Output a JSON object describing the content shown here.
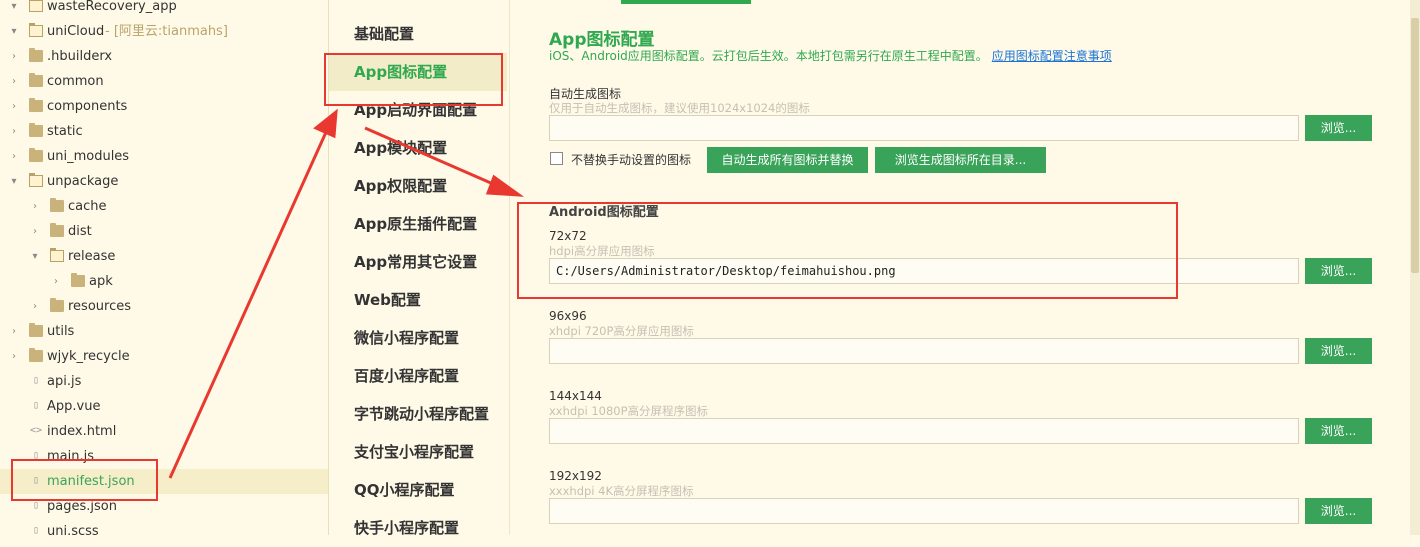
{
  "tree": {
    "items": [
      {
        "label": "wasteRecovery_app",
        "type": "folder-open",
        "level": 0
      },
      {
        "label": "uniCloud",
        "sub": "- [阿里云:tianmahs]",
        "type": "folder-open",
        "level": 0
      },
      {
        "label": ".hbuilderx",
        "type": "folder",
        "level": 0
      },
      {
        "label": "common",
        "type": "folder",
        "level": 0
      },
      {
        "label": "components",
        "type": "folder",
        "level": 0
      },
      {
        "label": "static",
        "type": "folder",
        "level": 0
      },
      {
        "label": "uni_modules",
        "type": "folder",
        "level": 0
      },
      {
        "label": "unpackage",
        "type": "folder-open",
        "level": 0
      },
      {
        "label": "cache",
        "type": "folder",
        "level": 1
      },
      {
        "label": "dist",
        "type": "folder",
        "level": 1
      },
      {
        "label": "release",
        "type": "folder-open",
        "level": 1
      },
      {
        "label": "apk",
        "type": "folder",
        "level": 2
      },
      {
        "label": "resources",
        "type": "folder",
        "level": 1
      },
      {
        "label": "utils",
        "type": "folder",
        "level": 0
      },
      {
        "label": "wjyk_recycle",
        "type": "folder",
        "level": 0
      },
      {
        "label": "api.js",
        "type": "file",
        "level": 0
      },
      {
        "label": "App.vue",
        "type": "file",
        "level": 0
      },
      {
        "label": "index.html",
        "type": "file",
        "level": 0
      },
      {
        "label": "main.js",
        "type": "file",
        "level": 0
      },
      {
        "label": "manifest.json",
        "type": "file",
        "level": 0,
        "selected": true
      },
      {
        "label": "pages.json",
        "type": "file",
        "level": 0
      },
      {
        "label": "uni.scss",
        "type": "file",
        "level": 0
      }
    ]
  },
  "nav": {
    "items": [
      {
        "label": "基础配置"
      },
      {
        "label": "App图标配置",
        "active": true
      },
      {
        "label": "App启动界面配置"
      },
      {
        "label": "App模块配置"
      },
      {
        "label": "App权限配置"
      },
      {
        "label": "App原生插件配置"
      },
      {
        "label": "App常用其它设置"
      },
      {
        "label": "Web配置"
      },
      {
        "label": "微信小程序配置"
      },
      {
        "label": "百度小程序配置"
      },
      {
        "label": "字节跳动小程序配置"
      },
      {
        "label": "支付宝小程序配置"
      },
      {
        "label": "QQ小程序配置"
      },
      {
        "label": "快手小程序配置"
      }
    ]
  },
  "main": {
    "title": "App图标配置",
    "desc": "iOS、Android应用图标配置。云打包后生效。本地打包需另行在原生工程中配置。",
    "desc_link": "应用图标配置注意事项",
    "auto": {
      "label": "自动生成图标",
      "hint": "仅用于自动生成图标，建议使用1024x1024的图标",
      "value": "",
      "browse": "浏览...",
      "checkbox_label": "不替换手动设置的图标",
      "checked": false,
      "generate_btn": "自动生成所有图标并替换",
      "browse_dir_btn": "浏览生成图标所在目录..."
    },
    "android": {
      "title": "Android图标配置",
      "icons": [
        {
          "size": "72x72",
          "hint": "hdpi高分屏应用图标",
          "value": "C:/Users/Administrator/Desktop/feimahuishou.png",
          "browse": "浏览..."
        },
        {
          "size": "96x96",
          "hint": "xhdpi 720P高分屏应用图标",
          "value": "",
          "browse": "浏览..."
        },
        {
          "size": "144x144",
          "hint": "xxhdpi 1080P高分屏程序图标",
          "value": "",
          "browse": "浏览..."
        },
        {
          "size": "192x192",
          "hint": "xxxhdpi 4K高分屏程序图标",
          "value": "",
          "browse": "浏览..."
        }
      ]
    }
  },
  "colors": {
    "accent": "#2fa84f",
    "button": "#3aa35a",
    "background": "#fffae8",
    "annotation": "#e8382f",
    "link": "#1a73d9"
  }
}
